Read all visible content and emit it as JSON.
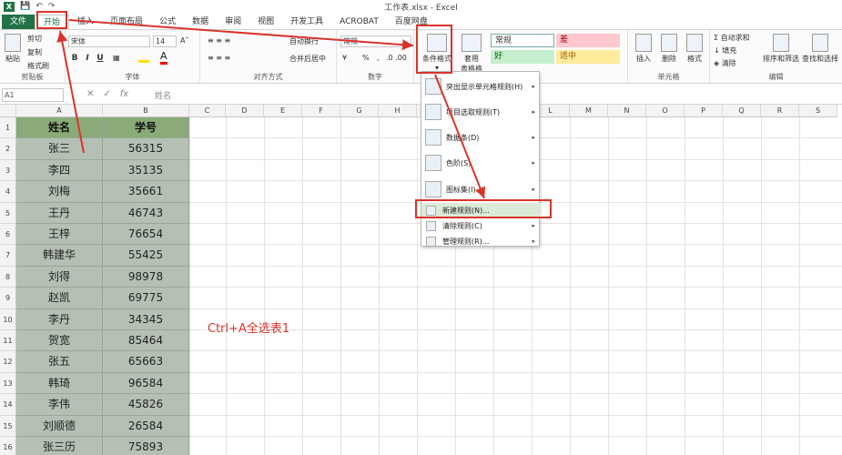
{
  "window": {
    "title": "工作表.xlsx - Excel"
  },
  "tabs": [
    "文件",
    "开始",
    "插入",
    "页面布局",
    "公式",
    "数据",
    "审阅",
    "视图",
    "开发工具",
    "ACROBAT",
    "百度网盘"
  ],
  "clipboard": {
    "paste": "粘贴",
    "cut": "剪切",
    "copy": "复制",
    "format_painter": "格式刷",
    "label": "剪贴板"
  },
  "font": {
    "name": "宋体",
    "size": "14",
    "bold": "B",
    "italic": "I",
    "underline": "U",
    "label": "字体"
  },
  "alignment": {
    "wrap": "自动换行",
    "merge": "合并后居中",
    "label": "对齐方式"
  },
  "number": {
    "format": "常规",
    "percent": "%",
    "comma": ",",
    "label": "数字"
  },
  "styles": {
    "cond_format": "条件格式",
    "table_format_1": "套用",
    "table_format_2": "表格格式",
    "normal": "常规",
    "bad": "差",
    "good": "好",
    "neutral": "适中"
  },
  "cells": {
    "insert": "插入",
    "delete": "删除",
    "format": "格式",
    "label": "单元格"
  },
  "editing": {
    "autosum": "自动求和",
    "fill": "填充",
    "clear": "清除",
    "sort_filter": "排序和筛选",
    "find_select": "查找和选择",
    "label": "编辑"
  },
  "formula_bar": {
    "name_box": "A1",
    "content": "姓名"
  },
  "columns": [
    "A",
    "B",
    "C",
    "D",
    "E",
    "F",
    "G",
    "H",
    "I",
    "J",
    "K",
    "L",
    "M",
    "N",
    "O",
    "P",
    "Q",
    "R",
    "S"
  ],
  "rows": [
    "1",
    "2",
    "3",
    "4",
    "5",
    "6",
    "7",
    "8",
    "9",
    "10",
    "11",
    "12",
    "13",
    "14",
    "15",
    "16"
  ],
  "table": {
    "headers": [
      "姓名",
      "学号"
    ],
    "data": [
      [
        "张三",
        "56315"
      ],
      [
        "李四",
        "35135"
      ],
      [
        "刘梅",
        "35661"
      ],
      [
        "王丹",
        "46743"
      ],
      [
        "王梓",
        "76654"
      ],
      [
        "韩建华",
        "55425"
      ],
      [
        "刘得",
        "98978"
      ],
      [
        "赵凯",
        "69775"
      ],
      [
        "李丹",
        "34345"
      ],
      [
        "贺宽",
        "85464"
      ],
      [
        "张五",
        "65663"
      ],
      [
        "韩琦",
        "96584"
      ],
      [
        "李伟",
        "45826"
      ],
      [
        "刘顺德",
        "26584"
      ],
      [
        "张三历",
        "75893"
      ]
    ]
  },
  "menu": {
    "items": [
      "突出显示单元格规则(H)",
      "项目选取规则(T)",
      "数据条(D)",
      "色阶(S)",
      "图标集(I)",
      "新建规则(N)...",
      "清除规则(C)",
      "管理规则(R)..."
    ]
  },
  "annotation": "Ctrl+A全选表1",
  "colors": {
    "excel_green": "#217346",
    "header_cell": "#8aaa78",
    "data_cell": "#b4c0b4",
    "highlight": "#d9342b",
    "bad_bg": "#ffc7ce",
    "good_bg": "#c6efce",
    "neutral_bg": "#ffeb9c"
  }
}
